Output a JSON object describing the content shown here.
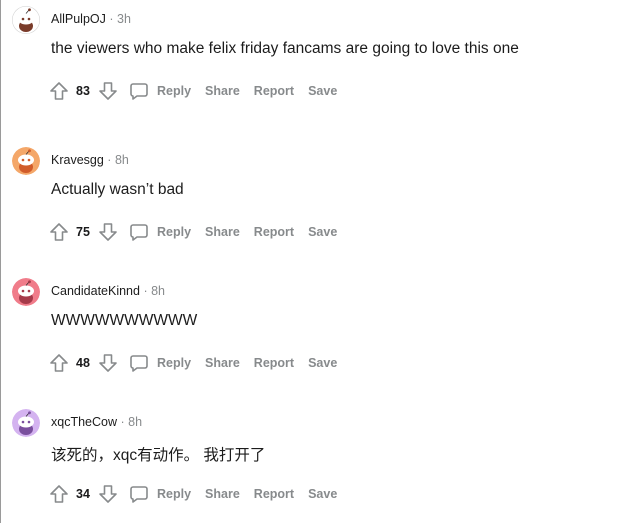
{
  "comments": [
    {
      "username": "AllPulpOJ",
      "separator": "·",
      "time": "3h",
      "text": "the viewers who make felix friday fancams are going to love this one",
      "votes": "83",
      "avatar_style": "snoo-in-snow",
      "avatar_bg": "#ffffff",
      "avatar_fg": "#7a3b2a"
    },
    {
      "username": "Kravesgg",
      "separator": "·",
      "time": "8h",
      "text": "Actually wasn’t bad",
      "votes": "75",
      "avatar_style": "snoo",
      "avatar_bg": "#f4a769",
      "avatar_fg": "#d15c2a"
    },
    {
      "username": "CandidateKinnd",
      "separator": "·",
      "time": "8h",
      "text": "WWWWWWWWWW",
      "votes": "48",
      "avatar_style": "snoo",
      "avatar_bg": "#f07c8a",
      "avatar_fg": "#a63a4a"
    },
    {
      "username": "xqcTheCow",
      "separator": "·",
      "time": "8h",
      "text": "该死的，xqc有动作。 我打开了",
      "votes": "34",
      "avatar_style": "snoo",
      "avatar_bg": "#d4b3f0",
      "avatar_fg": "#7a4f9e"
    }
  ],
  "actions": {
    "reply": "Reply",
    "share": "Share",
    "report": "Report",
    "save": "Save"
  },
  "colors": {
    "muted": "#878a8c",
    "text": "#1c1c1c"
  }
}
